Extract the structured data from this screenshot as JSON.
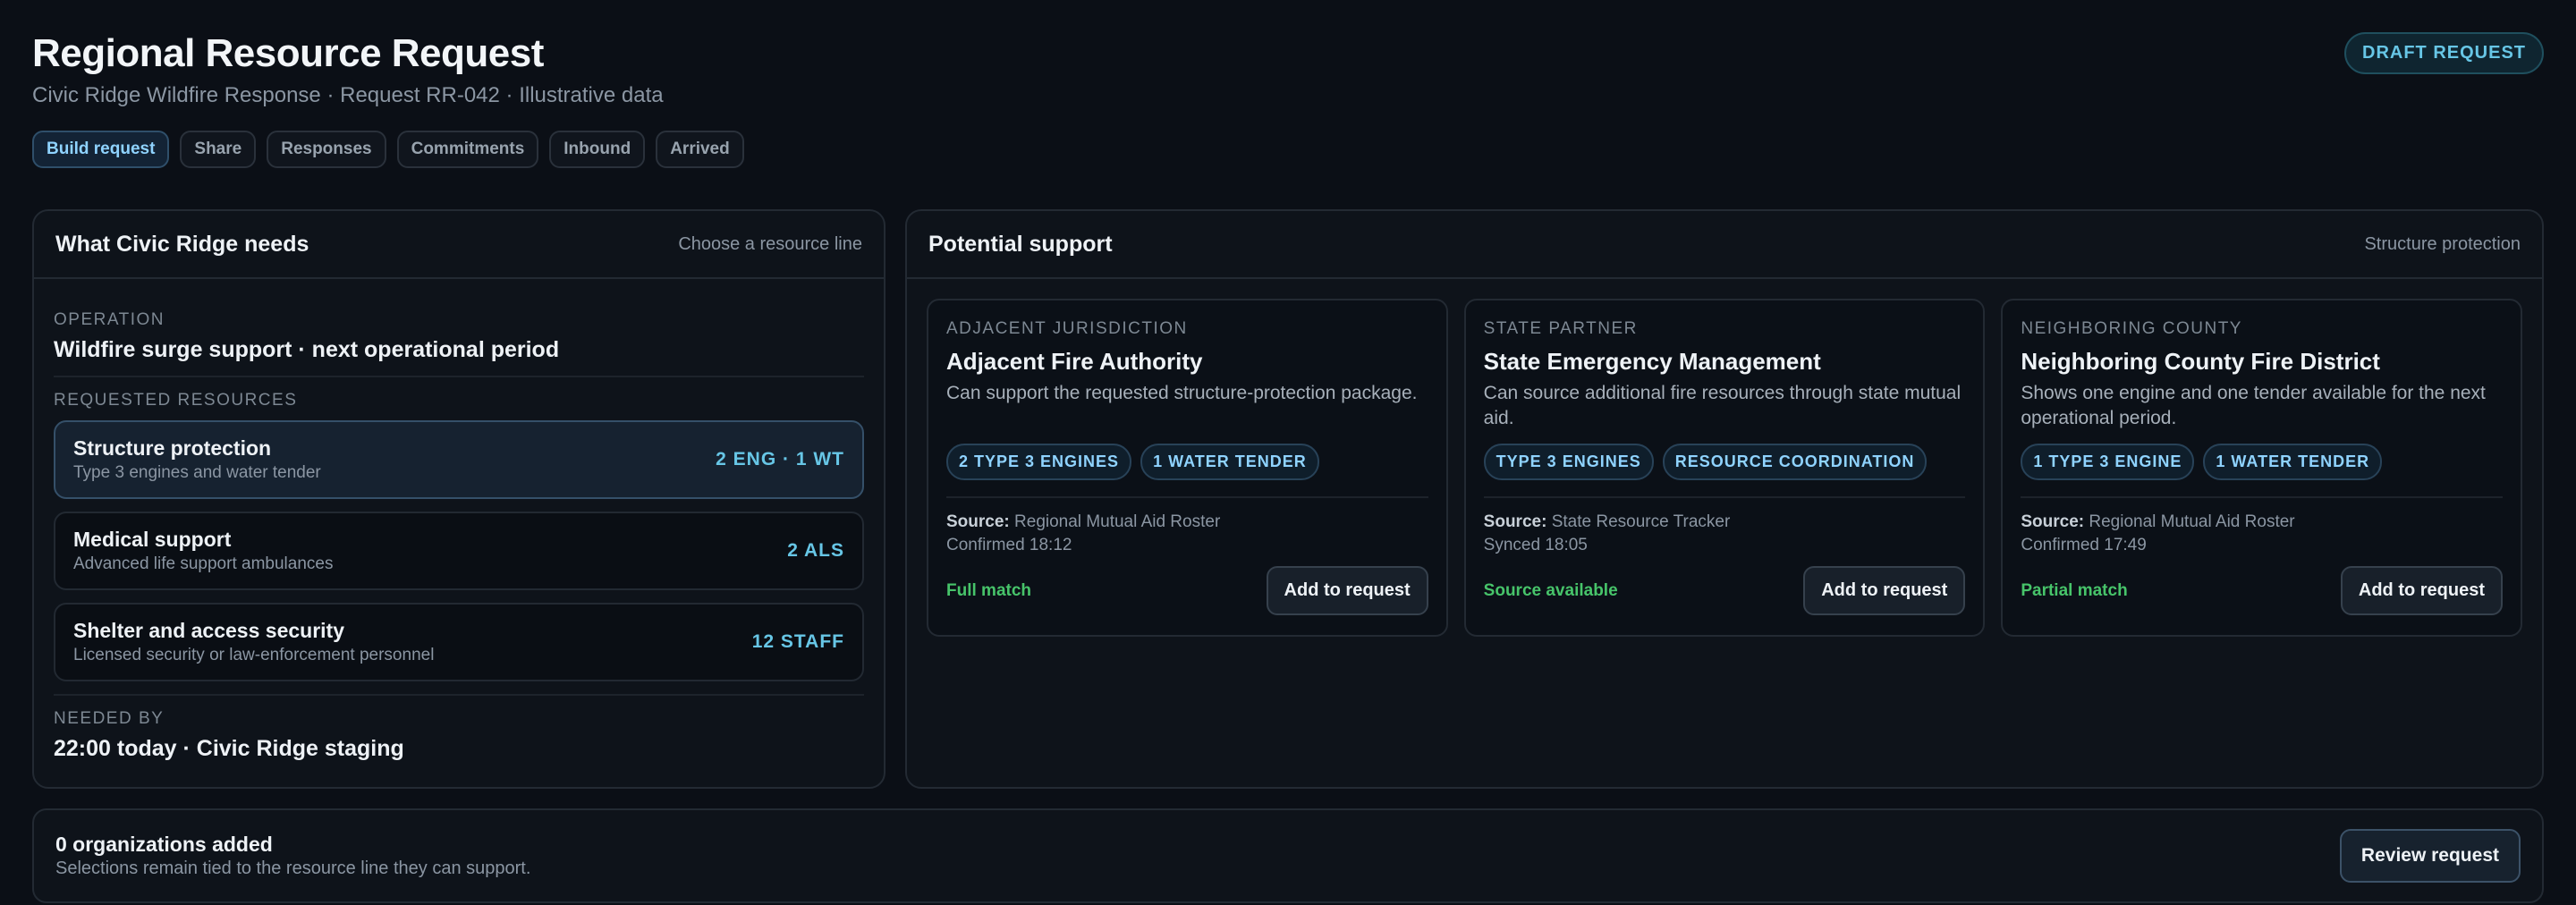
{
  "header": {
    "title": "Regional Resource Request",
    "subtitle": "Civic Ridge Wildfire Response · Request RR-042 · Illustrative data",
    "status_badge": "DRAFT REQUEST"
  },
  "tabs": [
    {
      "label": "Build request",
      "active": true
    },
    {
      "label": "Share",
      "active": false
    },
    {
      "label": "Responses",
      "active": false
    },
    {
      "label": "Commitments",
      "active": false
    },
    {
      "label": "Inbound",
      "active": false
    },
    {
      "label": "Arrived",
      "active": false
    }
  ],
  "needs_panel": {
    "title": "What Civic Ridge needs",
    "hint": "Choose a resource line",
    "operation_label": "OPERATION",
    "operation_value": "Wildfire surge support · next operational period",
    "resources_label": "REQUESTED RESOURCES",
    "resources": [
      {
        "name": "Structure protection",
        "description": "Type 3 engines and water tender",
        "quantity": "2 ENG · 1 WT",
        "selected": true
      },
      {
        "name": "Medical support",
        "description": "Advanced life support ambulances",
        "quantity": "2 ALS",
        "selected": false
      },
      {
        "name": "Shelter and access security",
        "description": "Licensed security or law-enforcement personnel",
        "quantity": "12 STAFF",
        "selected": false
      }
    ],
    "needed_by_label": "NEEDED BY",
    "needed_by_value": "22:00 today · Civic Ridge staging"
  },
  "support_panel": {
    "title": "Potential support",
    "hint": "Structure protection",
    "cards": [
      {
        "category": "ADJACENT JURISDICTION",
        "name": "Adjacent Fire Authority",
        "description": "Can support the requested structure-protection package.",
        "chips": [
          "2 TYPE 3 ENGINES",
          "1 WATER TENDER"
        ],
        "source_label": "Source:",
        "source": "Regional Mutual Aid Roster",
        "updated": "Confirmed 18:12",
        "match": "Full match",
        "action": "Add to request"
      },
      {
        "category": "STATE PARTNER",
        "name": "State Emergency Management",
        "description": "Can source additional fire resources through state mutual aid.",
        "chips": [
          "TYPE 3 ENGINES",
          "RESOURCE COORDINATION"
        ],
        "source_label": "Source:",
        "source": "State Resource Tracker",
        "updated": "Synced 18:05",
        "match": "Source available",
        "action": "Add to request"
      },
      {
        "category": "NEIGHBORING COUNTY",
        "name": "Neighboring County Fire District",
        "description": "Shows one engine and one tender available for the next operational period.",
        "chips": [
          "1 TYPE 3 ENGINE",
          "1 WATER TENDER"
        ],
        "source_label": "Source:",
        "source": "Regional Mutual Aid Roster",
        "updated": "Confirmed 17:49",
        "match": "Partial match",
        "action": "Add to request"
      }
    ]
  },
  "footer": {
    "title": "0 organizations added",
    "description": "Selections remain tied to the resource line they can support.",
    "review_label": "Review request"
  }
}
